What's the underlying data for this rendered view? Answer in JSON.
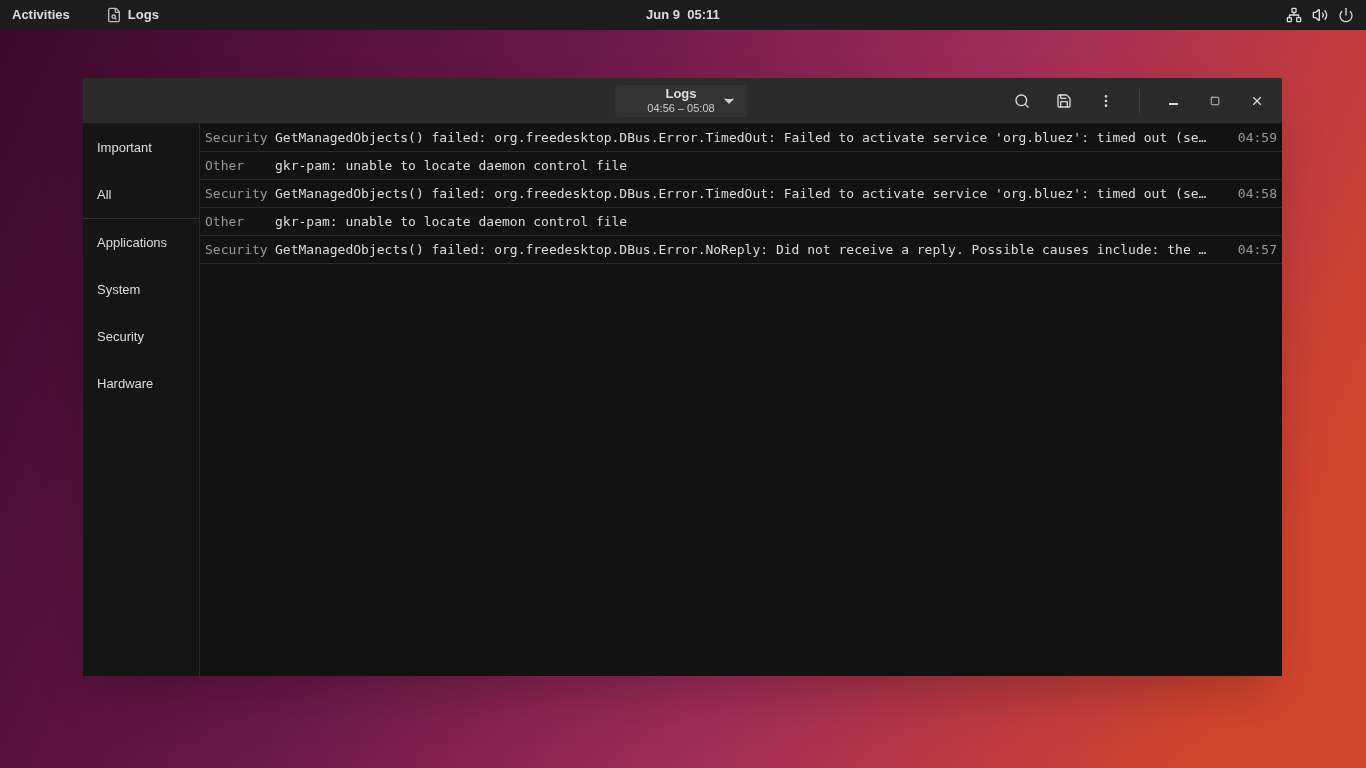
{
  "topbar": {
    "activities": "Activities",
    "app_name": "Logs",
    "clock": "Jun 9  05:11"
  },
  "window": {
    "title": "Logs",
    "subtitle": "04:56 – 05:08"
  },
  "sidebar": {
    "groups": [
      {
        "items": [
          "Important",
          "All"
        ]
      },
      {
        "items": [
          "Applications",
          "System",
          "Security",
          "Hardware"
        ]
      }
    ]
  },
  "log_rows": [
    {
      "category": "Security",
      "message": "GetManagedObjects() failed: org.freedesktop.DBus.Error.TimedOut: Failed to activate service 'org.bluez': timed out (se…",
      "time": "04:59"
    },
    {
      "category": "Other",
      "message": "gkr-pam: unable to locate daemon control file"
    },
    {
      "category": "Security",
      "message": "GetManagedObjects() failed: org.freedesktop.DBus.Error.TimedOut: Failed to activate service 'org.bluez': timed out (se…",
      "time": "04:58"
    },
    {
      "category": "Other",
      "message": "gkr-pam: unable to locate daemon control file"
    },
    {
      "category": "Security",
      "message": "GetManagedObjects() failed: org.freedesktop.DBus.Error.NoReply: Did not receive a reply. Possible causes include: the …",
      "time": "04:57"
    }
  ]
}
